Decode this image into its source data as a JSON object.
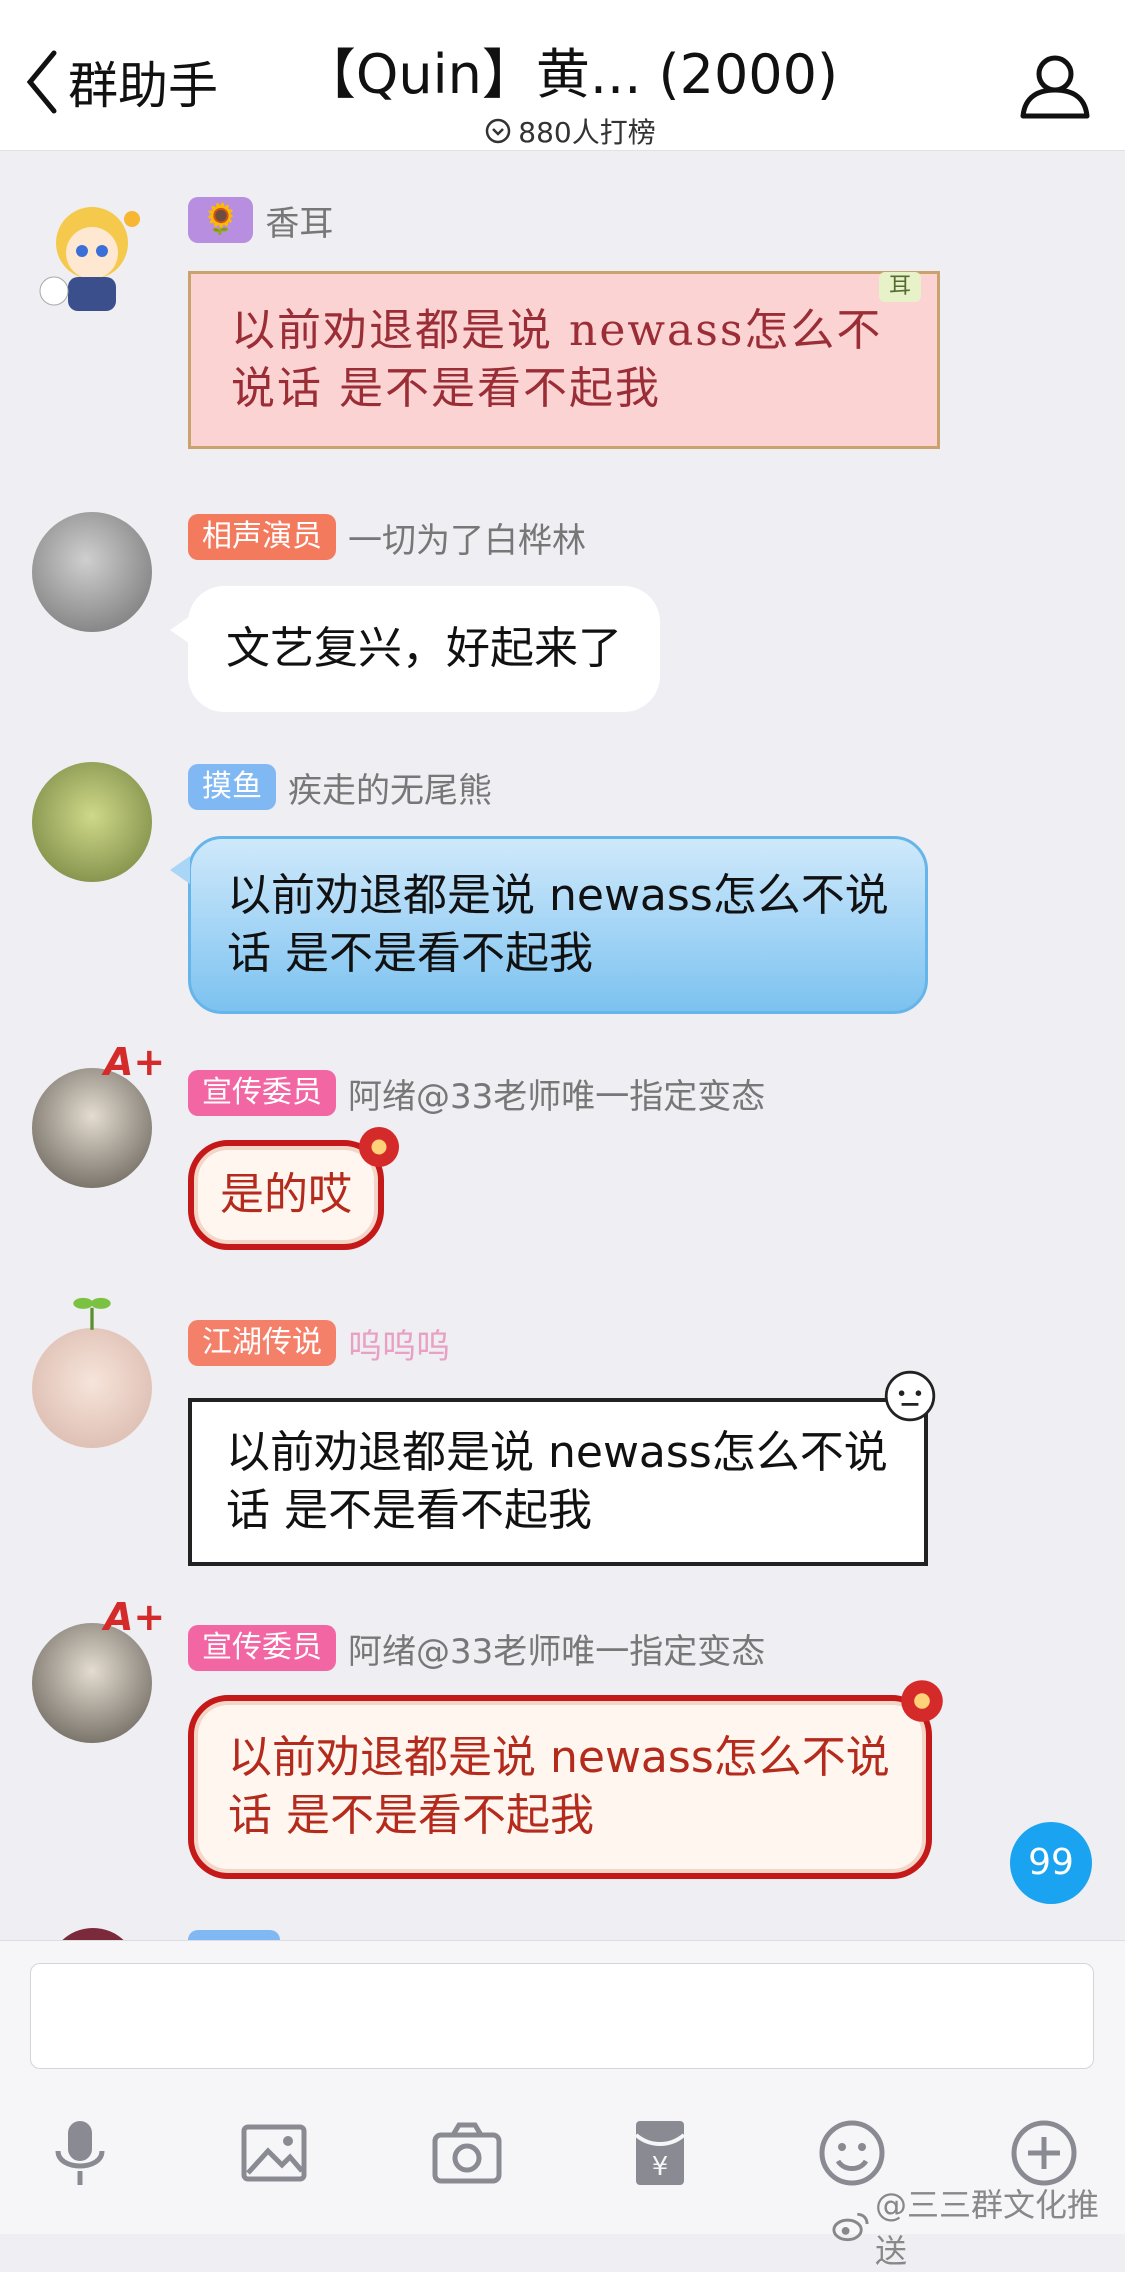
{
  "header": {
    "back_label": "群助手",
    "title": "【Quin】黄... (2000)",
    "subtitle": "880人打榜"
  },
  "messages": [
    {
      "badge": "🌻",
      "name": "香耳",
      "text": "以前劝退都是说 newass怎么不说话 是不是看不起我",
      "bubble_tag": "耳"
    },
    {
      "badge": "相声演员",
      "name": "一切为了白桦林",
      "text": "文艺复兴，好起来了"
    },
    {
      "badge": "摸鱼",
      "name": "疾走的无尾熊",
      "text": "以前劝退都是说 newass怎么不说话 是不是看不起我"
    },
    {
      "badge": "宣传委员",
      "name": "阿绪@33老师唯一指定变态",
      "text": "是的哎",
      "avatar_mark": "A+"
    },
    {
      "badge": "江湖传说",
      "name": "呜呜呜",
      "text": "以前劝退都是说 newass怎么不说话 是不是看不起我"
    },
    {
      "badge": "宣传委员",
      "name": "阿绪@33老师唯一指定变态",
      "text": "以前劝退都是说 newass怎么不说话 是不是看不起我",
      "avatar_mark": "A+"
    }
  ],
  "unread_count": "99",
  "watermark": "@三三群文化推送",
  "colors": {
    "badge_sunflower": "#b88ee0",
    "badge_xiangsheng": "#f47a5e",
    "badge_moyu": "#7fb8f2",
    "badge_xuanchuan": "#f266a3",
    "badge_jianghu": "#f4806a",
    "name_pink": "#e8a0c4",
    "accent_blue": "#1aa3f0"
  },
  "toolbar": [
    "microphone-icon",
    "image-icon",
    "camera-icon",
    "red-packet-icon",
    "emoji-icon",
    "plus-icon"
  ]
}
